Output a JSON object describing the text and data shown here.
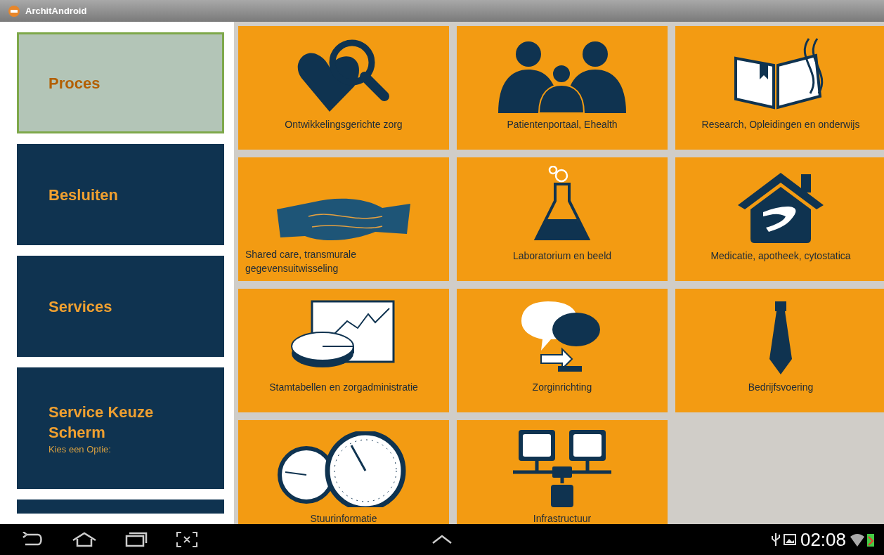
{
  "window": {
    "title": "ArchitAndroid"
  },
  "sidebar": {
    "items": [
      {
        "label": "Proces",
        "selected": true
      },
      {
        "label": "Besluiten",
        "selected": false
      },
      {
        "label": "Services",
        "selected": false
      },
      {
        "label": "Service Keuze Scherm",
        "subtitle": "Kies een Optie:",
        "selected": false
      }
    ]
  },
  "tiles": [
    {
      "label": "Ontwikkelingsgerichte zorg",
      "kind": "heart"
    },
    {
      "label": "Patientenportaal, Ehealth",
      "kind": "people"
    },
    {
      "label": "Research, Opleidingen en onderwijs",
      "kind": "book"
    },
    {
      "label": "Shared care, transmurale gegevensuitwisseling",
      "kind": "handshake"
    },
    {
      "label": "Laboratorium en beeld",
      "kind": "flask"
    },
    {
      "label": "Medicatie, apotheek, cytostatica",
      "kind": "house"
    },
    {
      "label": "Stamtabellen en zorgadministratie",
      "kind": "chart"
    },
    {
      "label": "Zorginrichting",
      "kind": "chat"
    },
    {
      "label": "Bedrijfsvoering",
      "kind": "tie"
    },
    {
      "label": "Stuurinformatie",
      "kind": "gauge"
    },
    {
      "label": "Infrastructuur",
      "kind": "network"
    }
  ],
  "status_bar": {
    "time": "02:08"
  }
}
